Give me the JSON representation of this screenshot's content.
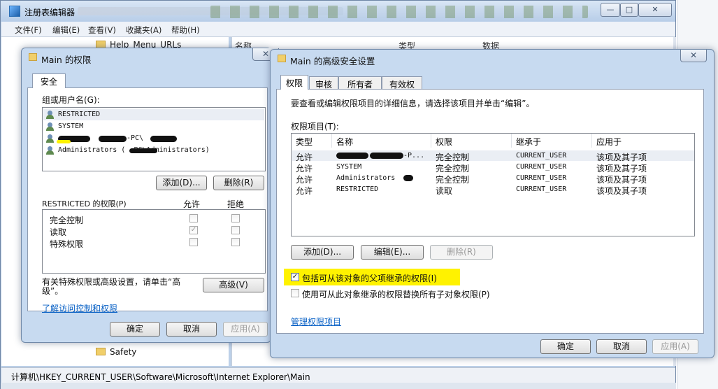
{
  "regedit": {
    "title": "注册表编辑器",
    "menu": [
      "文件(F)",
      "编辑(E)",
      "查看(V)",
      "收藏夹(A)",
      "帮助(H)"
    ],
    "columns": [
      "名称",
      "类型",
      "数据"
    ],
    "tree_items": [
      "Help_Menu_URLs",
      "Safety"
    ],
    "status_path": "计算机\\HKEY_CURRENT_USER\\Software\\Microsoft\\Internet Explorer\\Main",
    "window_buttons": [
      "—",
      "□",
      "✕"
    ]
  },
  "perm_dialog": {
    "title": "Main 的权限",
    "tab": "安全",
    "group_label": "组或用户名(G):",
    "users": [
      "RESTRICTED",
      "SYSTEM",
      "-PC\\",
      "Administrators (      -PC\\Administrators)"
    ],
    "add_btn": "添加(D)...",
    "remove_btn": "删除(R)",
    "perm_for": "RESTRICTED 的权限(P)",
    "allow_col": "允许",
    "deny_col": "拒绝",
    "permissions": [
      {
        "name": "完全控制",
        "allow": false,
        "deny": false
      },
      {
        "name": "读取",
        "allow": true,
        "deny": false
      },
      {
        "name": "特殊权限",
        "allow": false,
        "deny": false
      }
    ],
    "special_text": "有关特殊权限或高级设置，请单击“高级”。",
    "advanced_btn": "高级(V)",
    "learn_link": "了解访问控制和权限",
    "ok_btn": "确定",
    "cancel_btn": "取消",
    "apply_btn": "应用(A)"
  },
  "adv_dialog": {
    "title": "Main 的高级安全设置",
    "tabs": [
      "权限",
      "审核",
      "所有者",
      "有效权限"
    ],
    "instructions": "要查看或编辑权限项目的详细信息，请选择该项目并单击“编辑”。",
    "entries_label": "权限项目(T):",
    "columns": [
      "类型",
      "名称",
      "权限",
      "继承于",
      "应用于"
    ],
    "rows": [
      {
        "type": "允许",
        "name": "-P...",
        "perm": "完全控制",
        "inherit": "CURRENT_USER",
        "apply": "该项及其子项"
      },
      {
        "type": "允许",
        "name": "SYSTEM",
        "perm": "完全控制",
        "inherit": "CURRENT_USER",
        "apply": "该项及其子项"
      },
      {
        "type": "允许",
        "name": "Administrators",
        "perm": "完全控制",
        "inherit": "CURRENT_USER",
        "apply": "该项及其子项"
      },
      {
        "type": "允许",
        "name": "RESTRICTED",
        "perm": "读取",
        "inherit": "CURRENT_USER",
        "apply": "该项及其子项"
      }
    ],
    "add_btn": "添加(D)...",
    "edit_btn": "编辑(E)...",
    "remove_btn": "删除(R)",
    "inherit_checkbox": "包括可从该对象的父项继承的权限(I)",
    "replace_checkbox": "使用可从此对象继承的权限替换所有子对象权限(P)",
    "manage_link": "管理权限项目",
    "ok_btn": "确定",
    "cancel_btn": "取消",
    "apply_btn": "应用(A)"
  },
  "colors": {
    "highlight": "#fff200",
    "link": "#0a62c6",
    "title_bar": "#c7daf0"
  }
}
